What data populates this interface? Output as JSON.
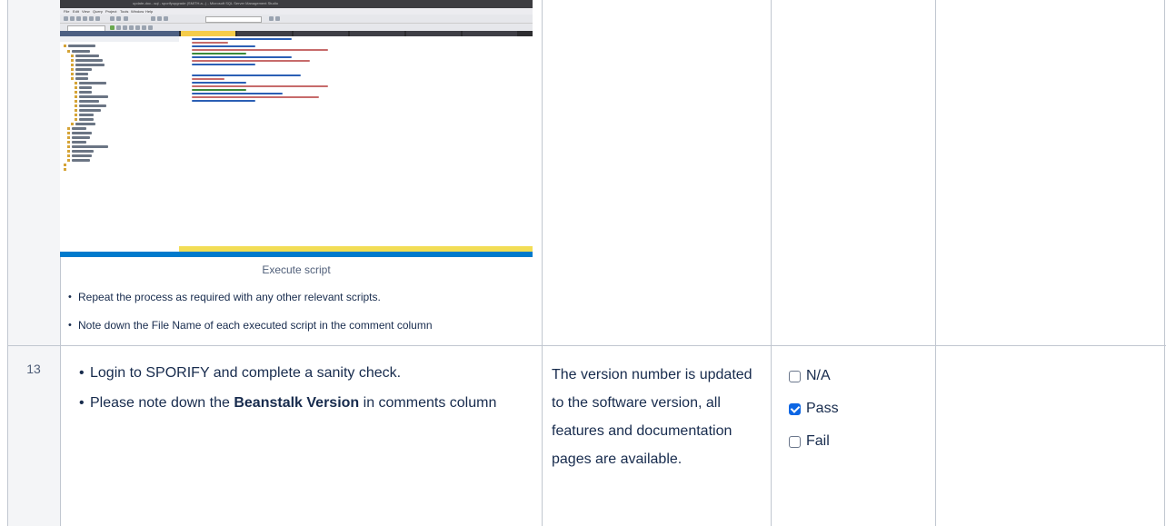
{
  "prev_row": {
    "screenshot": {
      "window_title": "update-doc...sql - sporifyupgrade (SMITH.a...) - Microsoft SQL Server Management Studio",
      "menu": [
        "File",
        "Edit",
        "View",
        "Query",
        "Project",
        "Tools",
        "Window",
        "Help"
      ]
    },
    "caption": "Execute script",
    "bullets": [
      "Repeat the process as required with any other relevant scripts.",
      "Note down the File Name of each executed script in the comment column"
    ]
  },
  "row": {
    "number": "13",
    "steps": {
      "step1": "Login to SPORIFY and complete a sanity check.",
      "step2_prefix": "Please note down the ",
      "step2_bold": "Beanstalk Version",
      "step2_suffix": " in comments column"
    },
    "expected": "The version number is updated to the software version, all features and documentation pages are available.",
    "options": [
      {
        "label": "N/A",
        "checked": false
      },
      {
        "label": "Pass",
        "checked": true
      },
      {
        "label": "Fail",
        "checked": false
      }
    ]
  }
}
